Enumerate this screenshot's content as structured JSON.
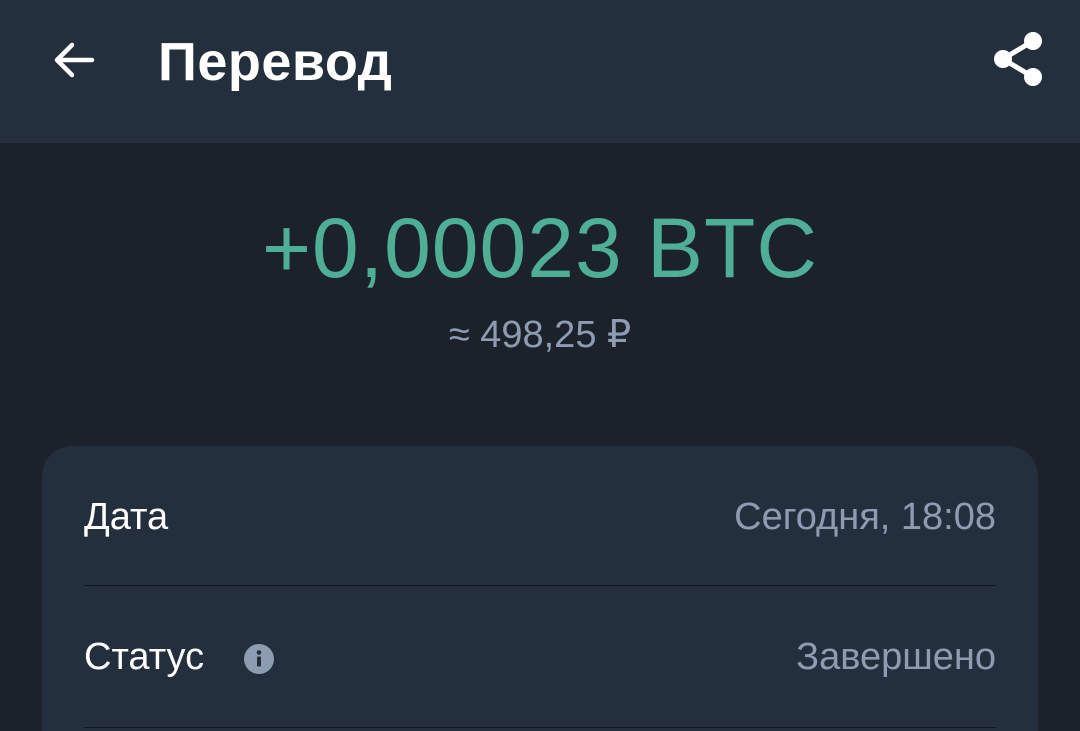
{
  "header": {
    "title": "Перевод",
    "back_icon": "arrow-left-icon",
    "share_icon": "share-icon"
  },
  "transaction": {
    "amount": "+0,00023 BTC",
    "fiat_equivalent": "≈ 498,25 ₽"
  },
  "details": [
    {
      "label": "Дата",
      "value": "Сегодня, 18:08"
    },
    {
      "label": "Статус",
      "value": "Завершено",
      "info_icon": "info-icon"
    }
  ],
  "colors": {
    "background": "#1b222c",
    "surface": "#242f3d",
    "accent_positive": "#4fae96",
    "text_primary": "#ffffff",
    "text_secondary": "#8e9cb1"
  }
}
